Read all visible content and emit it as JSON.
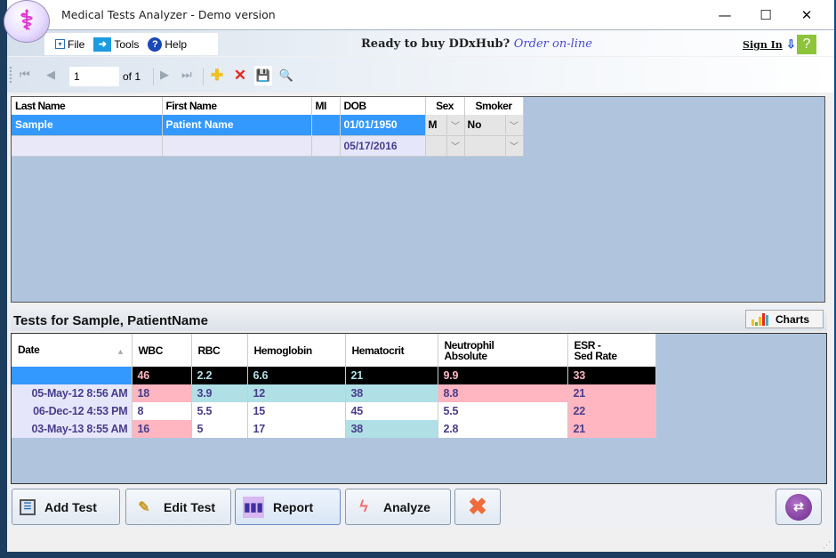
{
  "window": {
    "title": "Medical Tests Analyzer - Demo version",
    "logo_glyph": "⚕",
    "minimize": "—",
    "maximize": "☐",
    "close": "✕"
  },
  "menu": {
    "items": [
      {
        "label": "File",
        "icon": "file-download-icon"
      },
      {
        "label": "Tools",
        "icon": "arrow-right-icon"
      },
      {
        "label": "Help",
        "icon": "help-circle-icon"
      }
    ],
    "promo_text": "Ready to buy DDxHub?",
    "promo_link": "Order on-line",
    "sign_in": "Sign In",
    "download_glyph": "⇩",
    "help_glyph": "?"
  },
  "navigator": {
    "current_page": "1",
    "of_text": "of 1",
    "first_glyph": "⏮",
    "prev_glyph": "◀",
    "next_glyph": "▶",
    "last_glyph": "⏭",
    "add_glyph": "✚",
    "delete_glyph": "✕",
    "save_glyph": "💾",
    "preview_glyph": "🔍"
  },
  "patients": {
    "columns": [
      "Last Name",
      "First Name",
      "MI",
      "DOB",
      "Sex",
      "Smoker"
    ],
    "rows": [
      {
        "last": "Sample",
        "first": "Patient Name",
        "mi": "",
        "dob": "01/01/1950",
        "sex": "M",
        "smoker": "No"
      },
      {
        "last": "",
        "first": "",
        "mi": "",
        "dob": "05/17/2016",
        "sex": "",
        "smoker": ""
      }
    ],
    "dropdown_glyph": "﹀"
  },
  "tests": {
    "title": "Tests for Sample, PatientName",
    "charts_label": "Charts",
    "columns": [
      "Date",
      "WBC",
      "RBC",
      "Hemoglobin",
      "Hematocrit",
      "Neutrophil Absolute",
      "ESR - Sed Rate"
    ],
    "column_lines": [
      [
        "Date"
      ],
      [
        "WBC"
      ],
      [
        "RBC"
      ],
      [
        "Hemoglobin"
      ],
      [
        "Hematocrit"
      ],
      [
        "Neutrophil",
        "Absolute"
      ],
      [
        "ESR -",
        "Sed Rate"
      ]
    ],
    "sort_glyph": "▲",
    "reference_row": {
      "date": "",
      "values": [
        "46",
        "2.2",
        "6.6",
        "21",
        "9.9",
        "33"
      ],
      "text_colors": [
        "#ffb6c1",
        "#b0e0e6",
        "#b0e0e6",
        "#b0e0e6",
        "#ffb6c1",
        "#ffb6c1"
      ]
    },
    "rows": [
      {
        "date": "05-May-12 8:56 AM",
        "values": [
          "18",
          "3.9",
          "12",
          "38",
          "8.8",
          "21"
        ],
        "status": [
          "high",
          "low",
          "low",
          "low",
          "high",
          "high"
        ]
      },
      {
        "date": "06-Dec-12 4:53 PM",
        "values": [
          "8",
          "5.5",
          "15",
          "45",
          "5.5",
          "22"
        ],
        "status": [
          "normal",
          "normal",
          "normal",
          "normal",
          "normal",
          "high"
        ]
      },
      {
        "date": "03-May-13 8:55 AM",
        "values": [
          "16",
          "5",
          "17",
          "38",
          "2.8",
          "21"
        ],
        "status": [
          "high",
          "normal",
          "normal",
          "low",
          "normal",
          "high"
        ]
      }
    ],
    "status_colors": {
      "high": "#ffb6c1",
      "low": "#b0e0e6",
      "normal": "#ffffff"
    }
  },
  "actions": {
    "add_test": "Add Test",
    "edit_test": "Edit Test",
    "report": "Report",
    "analyze": "Analyze",
    "switch_glyph": "⇄",
    "resize_glyph": "⋰"
  }
}
